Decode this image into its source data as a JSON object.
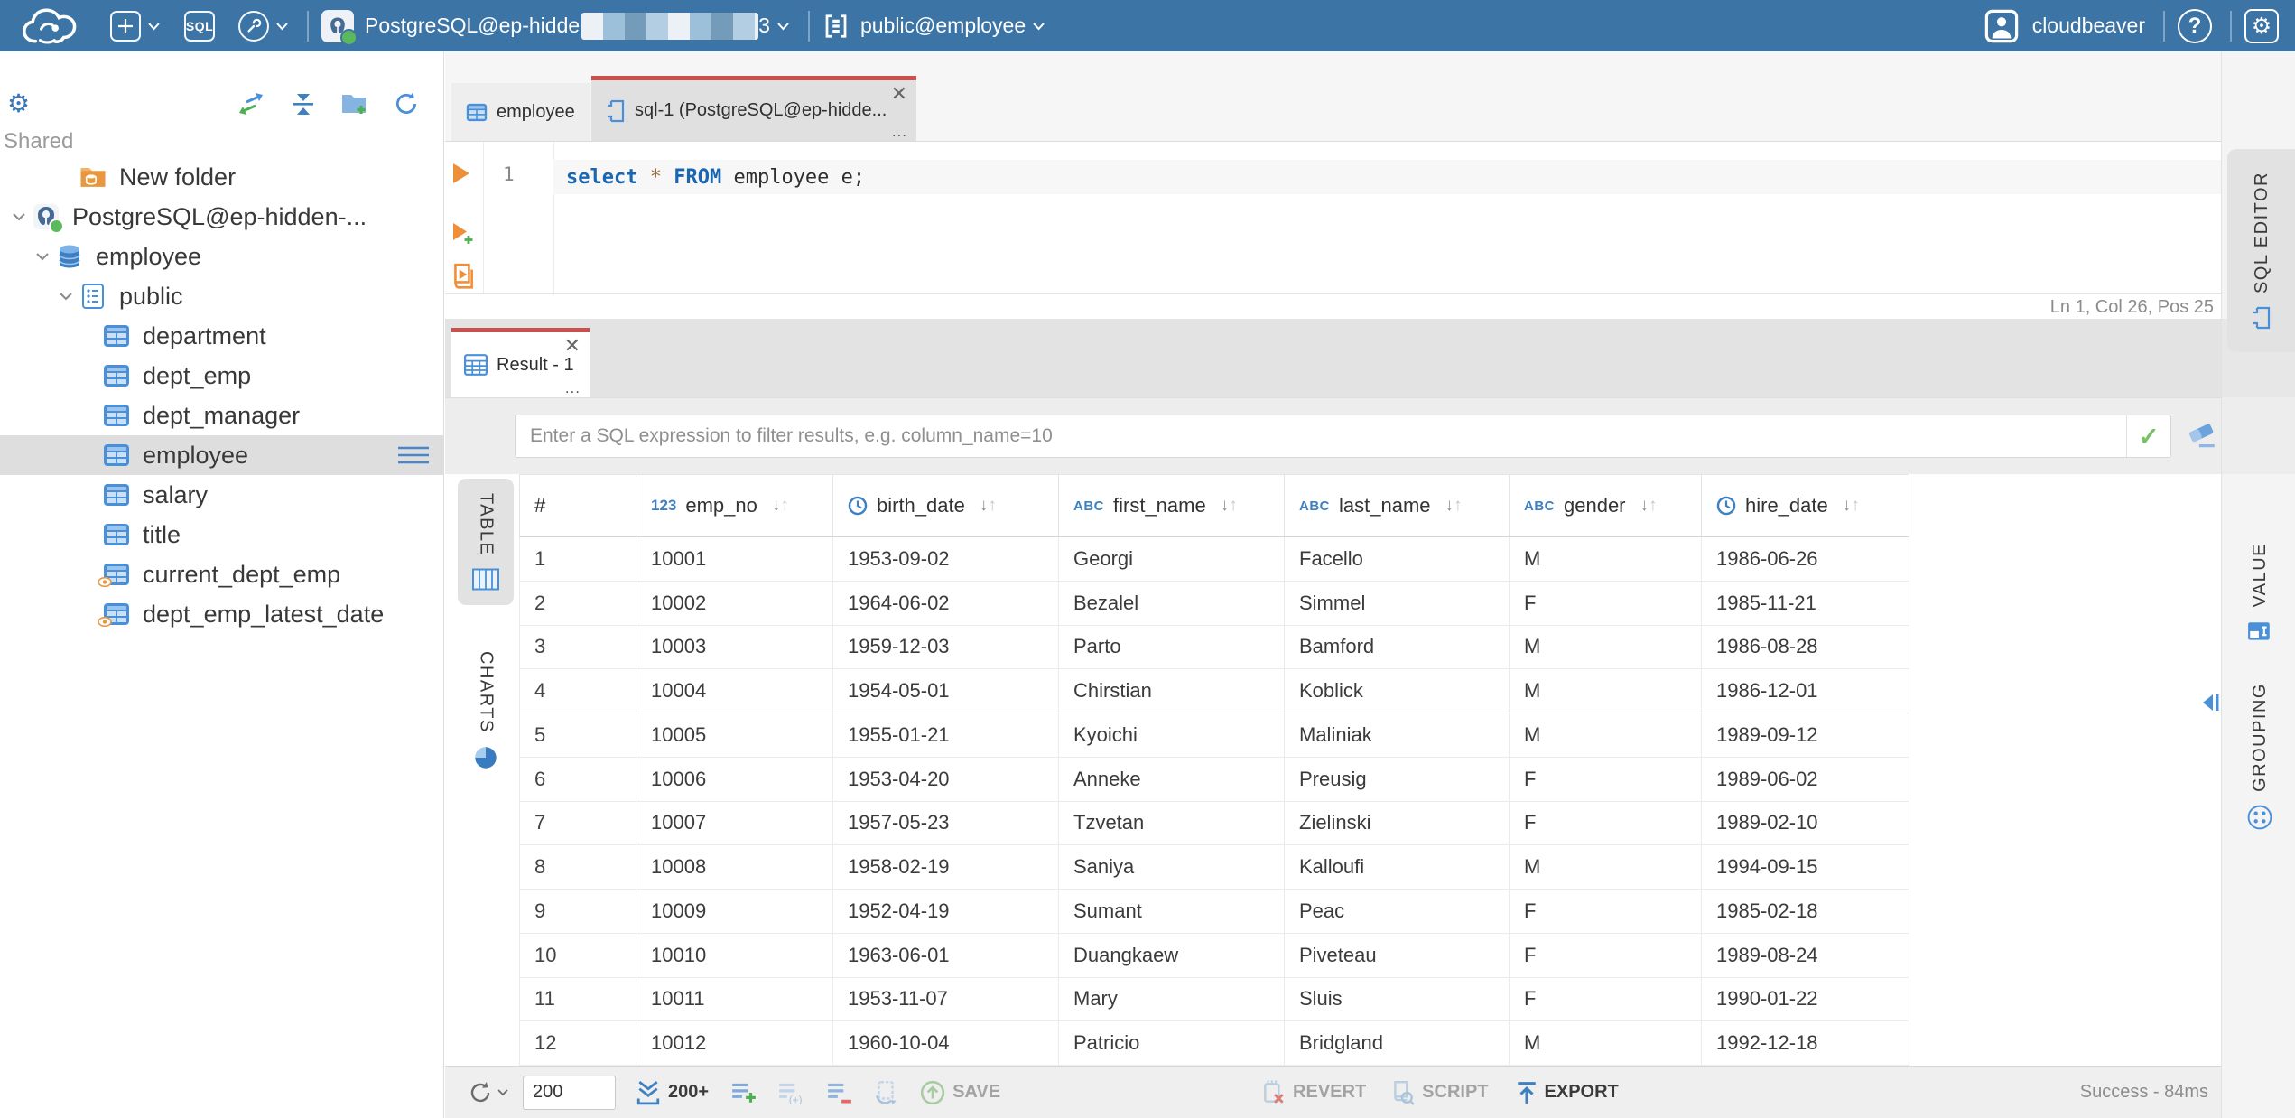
{
  "topbar": {
    "buttons": {
      "sql": "SQL"
    },
    "connection": {
      "name": "PostgreSQL@ep-hidde",
      "suffix": "3",
      "status": "connected"
    },
    "schema": {
      "name": "public@employee"
    },
    "user": {
      "name": "cloudbeaver"
    }
  },
  "sidebar": {
    "section": "Shared",
    "tree": [
      {
        "label": "New folder",
        "icon": "folder-db-icon",
        "level": 2,
        "chevron": false
      },
      {
        "label": "PostgreSQL@ep-hidden-...",
        "icon": "postgres-icon",
        "level": 0,
        "chevron": true,
        "status_dot": true
      },
      {
        "label": "employee",
        "icon": "database-icon",
        "level": 1,
        "chevron": true
      },
      {
        "label": "public",
        "icon": "schema-icon",
        "level": 2,
        "chevron": true
      },
      {
        "label": "department",
        "icon": "table-icon",
        "level": 3,
        "chevron": false
      },
      {
        "label": "dept_emp",
        "icon": "table-icon",
        "level": 3,
        "chevron": false
      },
      {
        "label": "dept_manager",
        "icon": "table-icon",
        "level": 3,
        "chevron": false
      },
      {
        "label": "employee",
        "icon": "table-icon",
        "level": 3,
        "chevron": false,
        "selected": true
      },
      {
        "label": "salary",
        "icon": "table-icon",
        "level": 3,
        "chevron": false
      },
      {
        "label": "title",
        "icon": "table-icon",
        "level": 3,
        "chevron": false
      },
      {
        "label": "current_dept_emp",
        "icon": "view-icon",
        "level": 3,
        "chevron": false
      },
      {
        "label": "dept_emp_latest_date",
        "icon": "view-icon",
        "level": 3,
        "chevron": false
      }
    ]
  },
  "editor": {
    "tabs": [
      {
        "label": "employee",
        "icon": "table-icon",
        "active": false
      },
      {
        "label": "sql-1 (PostgreSQL@ep-hidde...",
        "icon": "sql-script-icon",
        "active": true
      }
    ],
    "line_number": "1",
    "sql_tokens": [
      {
        "text": "select",
        "type": "keyword"
      },
      {
        "text": " ",
        "type": "plain"
      },
      {
        "text": "*",
        "type": "star"
      },
      {
        "text": " ",
        "type": "plain"
      },
      {
        "text": "FROM",
        "type": "keyword"
      },
      {
        "text": " employee e;",
        "type": "plain"
      }
    ],
    "status": "Ln 1, Col 26, Pos 25"
  },
  "results": {
    "tab_label": "Result - 1",
    "filter_placeholder": "Enter a SQL expression to filter results, e.g. column_name=10",
    "left_tabs": [
      "TABLE",
      "CHARTS"
    ],
    "right_tabs": [
      "SQL EDITOR",
      "VALUE",
      "GROUPING"
    ],
    "grid": {
      "columns": [
        {
          "label": "#",
          "type": "rownum"
        },
        {
          "label": "emp_no",
          "type": "number"
        },
        {
          "label": "birth_date",
          "type": "datetime"
        },
        {
          "label": "first_name",
          "type": "string"
        },
        {
          "label": "last_name",
          "type": "string"
        },
        {
          "label": "gender",
          "type": "string"
        },
        {
          "label": "hire_date",
          "type": "datetime"
        }
      ],
      "rows": [
        [
          "1",
          "10001",
          "1953-09-02",
          "Georgi",
          "Facello",
          "M",
          "1986-06-26"
        ],
        [
          "2",
          "10002",
          "1964-06-02",
          "Bezalel",
          "Simmel",
          "F",
          "1985-11-21"
        ],
        [
          "3",
          "10003",
          "1959-12-03",
          "Parto",
          "Bamford",
          "M",
          "1986-08-28"
        ],
        [
          "4",
          "10004",
          "1954-05-01",
          "Chirstian",
          "Koblick",
          "M",
          "1986-12-01"
        ],
        [
          "5",
          "10005",
          "1955-01-21",
          "Kyoichi",
          "Maliniak",
          "M",
          "1989-09-12"
        ],
        [
          "6",
          "10006",
          "1953-04-20",
          "Anneke",
          "Preusig",
          "F",
          "1989-06-02"
        ],
        [
          "7",
          "10007",
          "1957-05-23",
          "Tzvetan",
          "Zielinski",
          "F",
          "1989-02-10"
        ],
        [
          "8",
          "10008",
          "1958-02-19",
          "Saniya",
          "Kalloufi",
          "M",
          "1994-09-15"
        ],
        [
          "9",
          "10009",
          "1952-04-19",
          "Sumant",
          "Peac",
          "F",
          "1985-02-18"
        ],
        [
          "10",
          "10010",
          "1963-06-01",
          "Duangkaew",
          "Piveteau",
          "F",
          "1989-08-24"
        ],
        [
          "11",
          "10011",
          "1953-11-07",
          "Mary",
          "Sluis",
          "F",
          "1990-01-22"
        ],
        [
          "12",
          "10012",
          "1960-10-04",
          "Patricio",
          "Bridgland",
          "M",
          "1992-12-18"
        ]
      ]
    },
    "toolbar": {
      "row_limit": "200",
      "fetch_more": "200+",
      "save": "SAVE",
      "revert": "REVERT",
      "script": "SCRIPT",
      "export": "EXPORT",
      "status": "Success - 84ms"
    }
  },
  "colors": {
    "topbar_bg": "#3d74a6",
    "active_tab_accent": "#c9504c",
    "icon_blue": "#4a90d9",
    "keyword_blue": "#1a66b0",
    "success_green": "#5cb85c",
    "orange": "#ee8f3a"
  }
}
